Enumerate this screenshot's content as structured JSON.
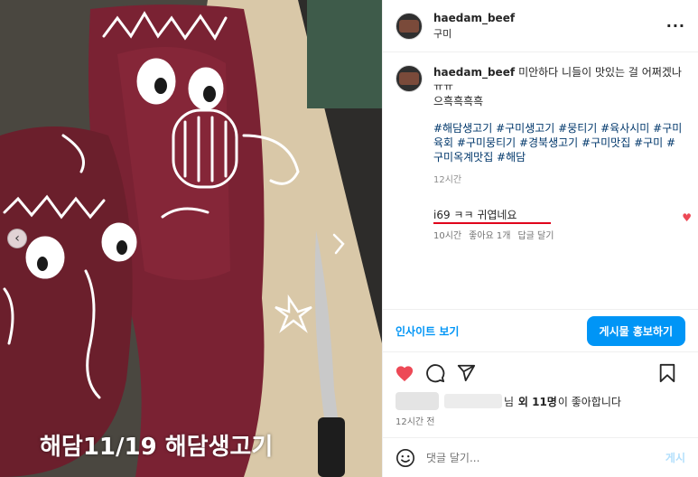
{
  "media": {
    "caption": "해담11/19 해담생고기",
    "prev_arrow": "‹"
  },
  "post": {
    "username": "haedam_beef",
    "location": "구미",
    "more_label": "···"
  },
  "caption": {
    "username": "haedam_beef",
    "text_line1": "미안하다 니들이 맛있는 걸 어쩌겠나 ㅠㅠ",
    "text_line2": "으흑흑흑흑",
    "hashtags": "#해담생고기 #구미생고기 #뭉티기 #육사시미 #구미육회 #구미뭉티기 #경북생고기 #구미맛집 #구미 #구미옥계맛집 #해담",
    "time": "12시간"
  },
  "reply": {
    "text": "i69 ㅋㅋ 귀엽네요",
    "time": "10시간",
    "likes": "좋아요 1개",
    "reply_label": "답글 달기"
  },
  "actions": {
    "insights": "인사이트 보기",
    "promote": "게시물 홍보하기"
  },
  "likes": {
    "suffix_prefix": "님",
    "others": "외 11명",
    "suffix": "이 좋아합니다"
  },
  "post_time": "12시간 전",
  "comment_box": {
    "placeholder": "댓글 달기...",
    "post_label": "게시"
  },
  "colors": {
    "accent": "#0095f6",
    "like_red": "#ed4956",
    "hashtag": "#00376b",
    "underline": "#e0001b"
  }
}
